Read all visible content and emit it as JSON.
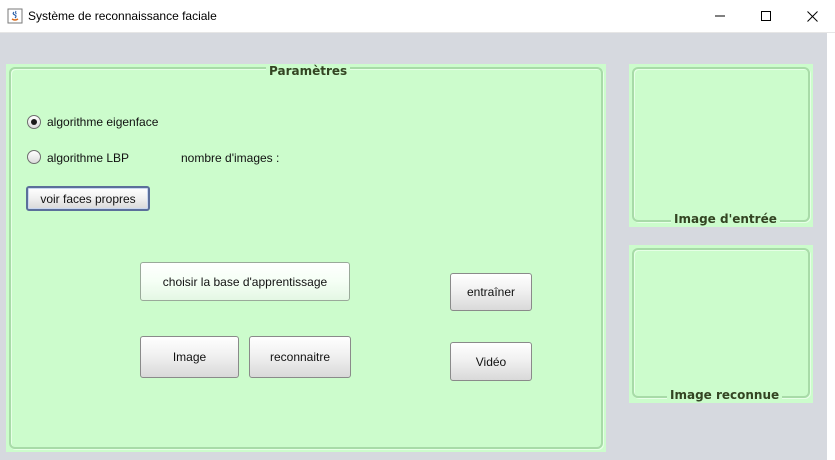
{
  "window": {
    "title": "Système de reconnaissance faciale",
    "controls": {
      "minimize": "minimize",
      "maximize": "maximize",
      "close": "close"
    }
  },
  "parametres": {
    "title": "Paramètres",
    "radio_eigenface": {
      "label": "algorithme eigenface",
      "checked": true
    },
    "radio_lbp": {
      "label": "algorithme LBP",
      "checked": false
    },
    "nombre_images_label": "nombre d'images :",
    "buttons": {
      "voir_faces_propres": "voir faces propres",
      "choisir_base": "choisir la base d'apprentissage",
      "entrainer": "entraîner",
      "image": "Image",
      "reconnaitre": "reconnaitre",
      "video": "Vidéo"
    }
  },
  "image_entree": {
    "title": "Image d'entrée"
  },
  "image_reconnue": {
    "title": "Image reconnue"
  },
  "colors": {
    "panel_bg": "#ccfccc",
    "panel_border": "#a8dba8",
    "client_bg": "#d6d9df",
    "title_text": "#334422"
  }
}
